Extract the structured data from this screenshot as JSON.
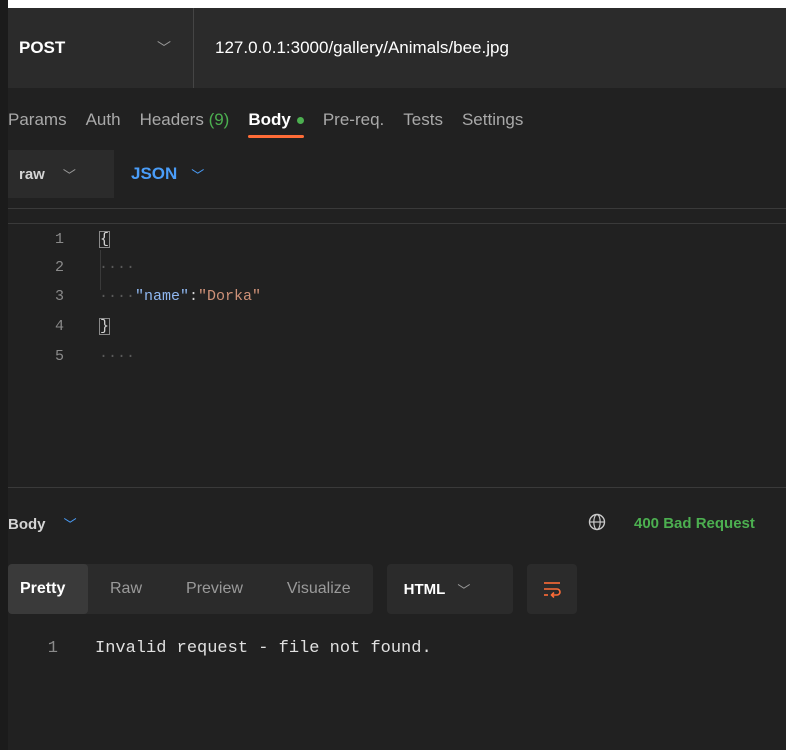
{
  "request": {
    "method": "POST",
    "url": "127.0.0.1:3000/gallery/Animals/bee.jpg"
  },
  "tabs": [
    {
      "label": "Params"
    },
    {
      "label": "Auth"
    },
    {
      "label": "Headers",
      "count": "(9)"
    },
    {
      "label": "Body",
      "active": true
    },
    {
      "label": "Pre-req."
    },
    {
      "label": "Tests"
    },
    {
      "label": "Settings"
    }
  ],
  "body_type": {
    "mode": "raw",
    "language": "JSON"
  },
  "editor": {
    "lines": [
      {
        "num": "1",
        "open": "{"
      },
      {
        "num": "2",
        "ws": "····"
      },
      {
        "num": "3",
        "ws": "····",
        "key": "\"name\"",
        "colon": ":",
        "value": "\"Dorka\""
      },
      {
        "num": "4",
        "close": "}"
      },
      {
        "num": "5",
        "ws": "····"
      }
    ]
  },
  "response": {
    "section_label": "Body",
    "status": "400 Bad Request",
    "tabs": [
      {
        "label": "Pretty",
        "active": true
      },
      {
        "label": "Raw"
      },
      {
        "label": "Preview"
      },
      {
        "label": "Visualize"
      }
    ],
    "format": "HTML",
    "lines": [
      {
        "num": "1",
        "text": "Invalid request - file not found."
      }
    ]
  },
  "colors": {
    "accent": "#ff6c37",
    "success": "#4caf50",
    "link": "#4a9df8"
  }
}
